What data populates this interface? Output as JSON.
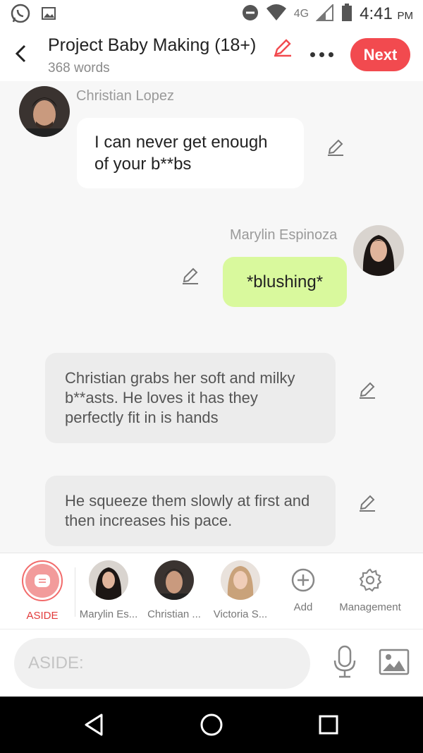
{
  "status_bar": {
    "time": "4:41",
    "ampm": "PM",
    "network": "4G",
    "icons": [
      "whatsapp-icon",
      "image-notification-icon",
      "do-not-disturb-icon",
      "wifi-icon",
      "signal-icon",
      "battery-icon"
    ]
  },
  "header": {
    "title": "Project Baby Making (18+)",
    "word_count": "368 words",
    "next_label": "Next",
    "accent_color": "#f24a4f"
  },
  "messages": [
    {
      "type": "character",
      "sender": "Christian Lopez",
      "text": "I can never get enough of your b**bs",
      "side": "left"
    },
    {
      "type": "character",
      "sender": "Marylin Espinoza",
      "text": "*blushing*",
      "side": "right"
    },
    {
      "type": "narration",
      "text": "Christian grabs her soft and milky b**asts. He loves it has they perfectly fit in is hands"
    },
    {
      "type": "narration",
      "text": "He squeeze them slowly at first and then increases his pace."
    }
  ],
  "characters": {
    "aside_label": "ASIDE",
    "items": [
      {
        "label": "Marylin Es..."
      },
      {
        "label": "Christian ..."
      },
      {
        "label": "Victoria S..."
      }
    ],
    "add_label": "Add",
    "management_label": "Management"
  },
  "input": {
    "placeholder": "ASIDE:"
  }
}
